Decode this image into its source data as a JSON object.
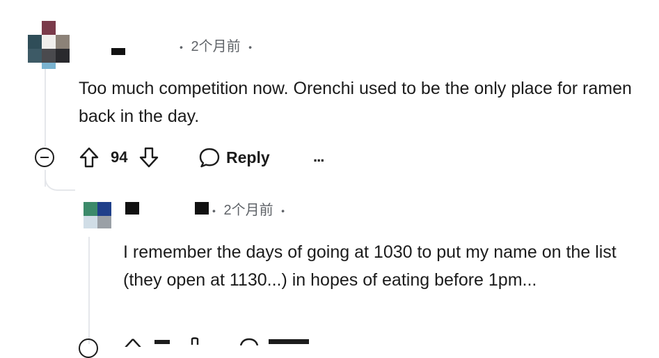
{
  "comments": [
    {
      "time": "2个月前",
      "text": "Too much competition now. Orenchi used to be the only place for ramen back in the day.",
      "upvotes": "94",
      "reply_label": "Reply",
      "more_label": "..."
    },
    {
      "time": "2个月前",
      "text": "I remember the days of going at 1030 to put my name on the list (they open at 1130...) in hopes of eating before 1pm..."
    }
  ],
  "separator": "•",
  "icons": {
    "collapse": "collapse-icon",
    "upvote": "upvote-arrow-icon",
    "downvote": "downvote-arrow-icon",
    "reply": "speech-bubble-icon",
    "more": "ellipsis-icon"
  }
}
